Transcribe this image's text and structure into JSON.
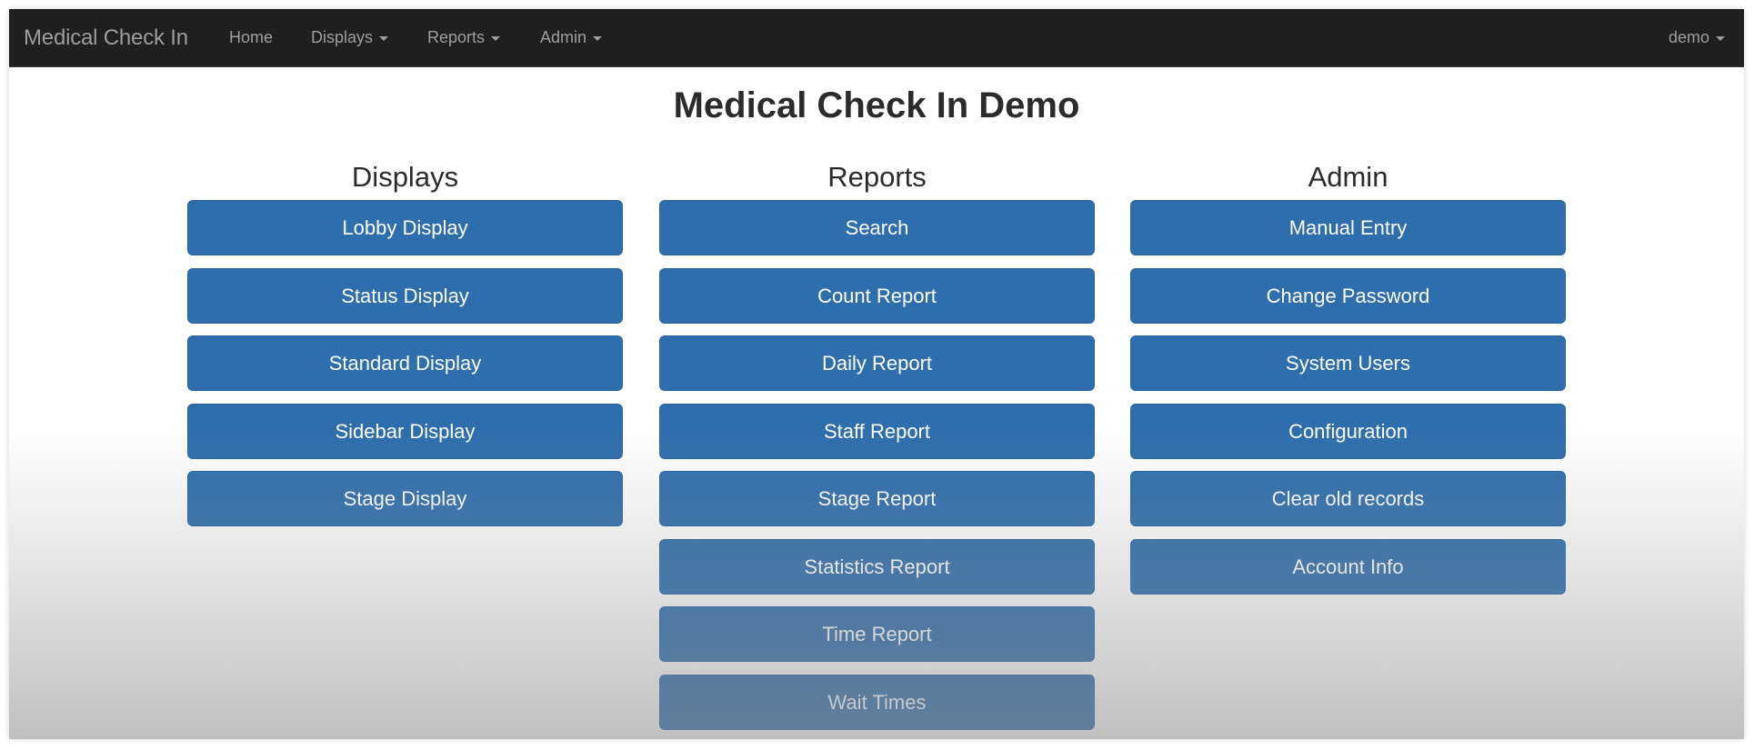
{
  "navbar": {
    "brand": "Medical Check In",
    "items": [
      {
        "label": "Home",
        "dropdown": false
      },
      {
        "label": "Displays",
        "dropdown": true
      },
      {
        "label": "Reports",
        "dropdown": true
      },
      {
        "label": "Admin",
        "dropdown": true
      }
    ],
    "user": {
      "label": "demo",
      "dropdown": true
    }
  },
  "page": {
    "title": "Medical Check In Demo"
  },
  "sections": [
    {
      "heading": "Displays",
      "buttons": [
        "Lobby Display",
        "Status Display",
        "Standard Display",
        "Sidebar Display",
        "Stage Display"
      ]
    },
    {
      "heading": "Reports",
      "buttons": [
        "Search",
        "Count Report",
        "Daily Report",
        "Staff Report",
        "Stage Report",
        "Statistics Report",
        "Time Report",
        "Wait Times"
      ]
    },
    {
      "heading": "Admin",
      "buttons": [
        "Manual Entry",
        "Change Password",
        "System Users",
        "Configuration",
        "Clear old records",
        "Account Info"
      ]
    }
  ],
  "colors": {
    "navbar_bg": "#1f1f1f",
    "navbar_text": "#9d9d9d",
    "button_primary": "#2e6eac",
    "button_text": "#ffffff",
    "heading_text": "#2b2b2b"
  }
}
